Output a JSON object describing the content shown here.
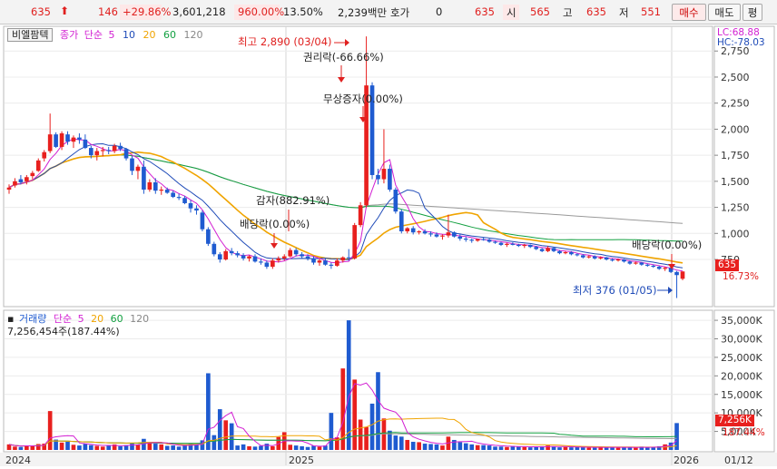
{
  "topbar": {
    "price": "635",
    "arrow": "⬆",
    "change": "146",
    "change_pct": "+29.86%",
    "volume": "3,601,218",
    "vol_ratio": "960.00%",
    "turnover": "13.50%",
    "amount": "2,239백만",
    "quote_label": "호가",
    "quote_value": "0",
    "bid": "635",
    "open_label": "시",
    "open_value": "565",
    "high_label": "고",
    "high_value": "635",
    "low_label": "저",
    "low_value": "551",
    "buy_label": "매수",
    "sell_label": "매도",
    "eval_label": "평"
  },
  "price_panel": {
    "stock_name": "비엘팜텍",
    "legend_prefix": "종가",
    "legend_type": "단순",
    "periods": [
      "5",
      "10",
      "20",
      "60",
      "120"
    ],
    "lc": "LC:68.88",
    "hc": "HC:-78.03",
    "current_badge": "635",
    "current_pct": "16.73%",
    "y_ticks": [
      "2,750",
      "2,500",
      "2,250",
      "2,000",
      "1,750",
      "1,500",
      "1,250",
      "1,000",
      "750"
    ],
    "y_range": [
      376,
      2900
    ],
    "annotations": {
      "high": "최고 2,890 (03/04)",
      "rights": "권리락(-66.66%)",
      "bonus": "무상증자(0.00%)",
      "reduction": "감자(882.91%)",
      "dividend1": "배당락(0.00%)",
      "dividend2": "배당락(0.00%)",
      "low": "최저 376 (01/05)"
    }
  },
  "volume_panel": {
    "legend_prefix": "거래량",
    "legend_type": "단순",
    "periods": [
      "5",
      "20",
      "60",
      "120"
    ],
    "volume_text": "7,256,454주(187.44%)",
    "current_badge": "7,256K",
    "current_pct": "187.44%",
    "y_ticks": [
      "35,000K",
      "30,000K",
      "25,000K",
      "20,000K",
      "15,000K",
      "10,000K",
      "5,000K"
    ],
    "y_range": [
      0,
      36000
    ]
  },
  "x_axis": {
    "labels": [
      "2024",
      "2025",
      "2026"
    ],
    "current_date": "01/12"
  },
  "colors": {
    "up": "#e8201e",
    "down": "#1f5bd0",
    "ma5": "#d21fd2",
    "ma10": "#1f4bb8",
    "ma20": "#f0a400",
    "ma60": "#12a040",
    "ma120": "#9a9a9a"
  },
  "chart_data": {
    "type": "candlestick",
    "price_ohlc": [
      [
        1420,
        1470,
        1380,
        1440
      ],
      [
        1460,
        1530,
        1440,
        1500
      ],
      [
        1520,
        1560,
        1470,
        1490
      ],
      [
        1500,
        1560,
        1470,
        1540
      ],
      [
        1550,
        1600,
        1520,
        1580
      ],
      [
        1600,
        1720,
        1590,
        1700
      ],
      [
        1720,
        1800,
        1690,
        1780
      ],
      [
        1790,
        2150,
        1770,
        1950
      ],
      [
        1950,
        1970,
        1820,
        1830
      ],
      [
        1830,
        1980,
        1800,
        1960
      ],
      [
        1950,
        1980,
        1850,
        1880
      ],
      [
        1880,
        1940,
        1820,
        1920
      ],
      [
        1920,
        1960,
        1860,
        1900
      ],
      [
        1900,
        1950,
        1810,
        1820
      ],
      [
        1820,
        1840,
        1720,
        1750
      ],
      [
        1750,
        1820,
        1700,
        1790
      ],
      [
        1790,
        1830,
        1740,
        1800
      ],
      [
        1800,
        1830,
        1760,
        1790
      ],
      [
        1790,
        1860,
        1770,
        1840
      ],
      [
        1840,
        1870,
        1790,
        1810
      ],
      [
        1810,
        1820,
        1700,
        1720
      ],
      [
        1720,
        1740,
        1560,
        1600
      ],
      [
        1600,
        1660,
        1520,
        1640
      ],
      [
        1640,
        1700,
        1380,
        1420
      ],
      [
        1420,
        1520,
        1400,
        1490
      ],
      [
        1490,
        1530,
        1380,
        1410
      ],
      [
        1410,
        1450,
        1370,
        1420
      ],
      [
        1420,
        1440,
        1380,
        1390
      ],
      [
        1390,
        1410,
        1340,
        1350
      ],
      [
        1350,
        1380,
        1320,
        1340
      ],
      [
        1340,
        1360,
        1280,
        1290
      ],
      [
        1290,
        1320,
        1200,
        1240
      ],
      [
        1240,
        1270,
        1180,
        1220
      ],
      [
        1200,
        1220,
        1020,
        1040
      ],
      [
        1040,
        1060,
        880,
        900
      ],
      [
        900,
        920,
        780,
        800
      ],
      [
        800,
        820,
        720,
        750
      ],
      [
        750,
        850,
        740,
        830
      ],
      [
        830,
        860,
        790,
        810
      ],
      [
        810,
        830,
        770,
        790
      ],
      [
        790,
        810,
        740,
        760
      ],
      [
        760,
        790,
        730,
        780
      ],
      [
        780,
        800,
        720,
        730
      ],
      [
        730,
        760,
        700,
        720
      ],
      [
        720,
        740,
        660,
        680
      ],
      [
        680,
        760,
        660,
        740
      ],
      [
        740,
        780,
        720,
        760
      ],
      [
        760,
        800,
        740,
        780
      ],
      [
        780,
        860,
        770,
        840
      ],
      [
        840,
        860,
        780,
        800
      ],
      [
        800,
        820,
        760,
        780
      ],
      [
        780,
        800,
        740,
        760
      ],
      [
        760,
        780,
        700,
        720
      ],
      [
        720,
        760,
        690,
        740
      ],
      [
        740,
        760,
        690,
        700
      ],
      [
        700,
        720,
        660,
        690
      ],
      [
        690,
        760,
        680,
        740
      ],
      [
        740,
        780,
        720,
        770
      ],
      [
        770,
        850,
        740,
        760
      ],
      [
        760,
        1100,
        750,
        1080
      ],
      [
        1080,
        1300,
        1060,
        1270
      ],
      [
        1270,
        2890,
        1250,
        2420
      ],
      [
        2420,
        2450,
        1520,
        1560
      ],
      [
        1560,
        1620,
        1470,
        1520
      ],
      [
        1520,
        2000,
        1480,
        1620
      ],
      [
        1620,
        1660,
        1400,
        1420
      ],
      [
        1420,
        1440,
        1190,
        1210
      ],
      [
        1210,
        1230,
        1000,
        1020
      ],
      [
        1020,
        1060,
        1000,
        1050
      ],
      [
        1050,
        1070,
        990,
        1010
      ],
      [
        1010,
        1030,
        990,
        1020
      ],
      [
        1020,
        1040,
        990,
        1000
      ],
      [
        1000,
        1020,
        970,
        990
      ],
      [
        990,
        1010,
        960,
        970
      ],
      [
        970,
        990,
        940,
        980
      ],
      [
        980,
        1180,
        960,
        1010
      ],
      [
        1010,
        1020,
        960,
        970
      ],
      [
        970,
        990,
        930,
        950
      ],
      [
        950,
        970,
        920,
        940
      ],
      [
        940,
        950,
        910,
        930
      ],
      [
        930,
        950,
        920,
        945
      ],
      [
        945,
        960,
        930,
        940
      ],
      [
        940,
        950,
        910,
        920
      ],
      [
        920,
        930,
        900,
        910
      ],
      [
        910,
        920,
        880,
        890
      ],
      [
        890,
        910,
        870,
        900
      ],
      [
        900,
        915,
        885,
        890
      ],
      [
        890,
        900,
        870,
        880
      ],
      [
        880,
        900,
        860,
        890
      ],
      [
        890,
        895,
        860,
        870
      ],
      [
        870,
        880,
        840,
        850
      ],
      [
        850,
        860,
        820,
        830
      ],
      [
        830,
        880,
        820,
        860
      ],
      [
        860,
        870,
        820,
        830
      ],
      [
        830,
        840,
        800,
        810
      ],
      [
        810,
        830,
        800,
        820
      ],
      [
        820,
        830,
        790,
        800
      ],
      [
        800,
        810,
        780,
        790
      ],
      [
        790,
        800,
        760,
        770
      ],
      [
        770,
        790,
        760,
        780
      ],
      [
        780,
        790,
        750,
        760
      ],
      [
        760,
        780,
        750,
        770
      ],
      [
        770,
        775,
        740,
        750
      ],
      [
        750,
        760,
        730,
        740
      ],
      [
        740,
        760,
        730,
        750
      ],
      [
        750,
        755,
        720,
        730
      ],
      [
        730,
        740,
        700,
        710
      ],
      [
        710,
        730,
        700,
        720
      ],
      [
        720,
        725,
        690,
        700
      ],
      [
        700,
        710,
        680,
        690
      ],
      [
        690,
        700,
        670,
        680
      ],
      [
        680,
        690,
        650,
        660
      ],
      [
        660,
        680,
        640,
        670
      ],
      [
        670,
        680,
        620,
        630
      ],
      [
        630,
        640,
        380,
        600
      ],
      [
        565,
        635,
        551,
        635
      ]
    ],
    "volume_k": [
      1500,
      900,
      800,
      1200,
      1100,
      1600,
      1700,
      10500,
      2800,
      2000,
      2200,
      1400,
      1200,
      1600,
      1300,
      1100,
      900,
      1200,
      1500,
      1000,
      1300,
      1700,
      1400,
      3000,
      2200,
      1700,
      1500,
      1100,
      1200,
      900,
      1300,
      1800,
      1500,
      2600,
      20700,
      4000,
      11000,
      8000,
      7200,
      1200,
      1500,
      1000,
      900,
      1100,
      1700,
      1000,
      3500,
      4800,
      1400,
      1200,
      1000,
      800,
      1100,
      900,
      1200,
      10000,
      3400,
      22000,
      35000,
      19000,
      8200,
      6200,
      12500,
      21000,
      8500,
      5200,
      3900,
      3600,
      2700,
      2200,
      2100,
      1700,
      1600,
      1500,
      1200,
      3600,
      2700,
      2100,
      1800,
      1500,
      1300,
      1300,
      1200,
      900,
      900,
      800,
      1100,
      900,
      800,
      700,
      800,
      1000,
      1200,
      900,
      700,
      800,
      700,
      900,
      700,
      600,
      600,
      800,
      700,
      800,
      600,
      700,
      700,
      600,
      900,
      700,
      800,
      1000,
      1500,
      2000,
      7256
    ]
  }
}
